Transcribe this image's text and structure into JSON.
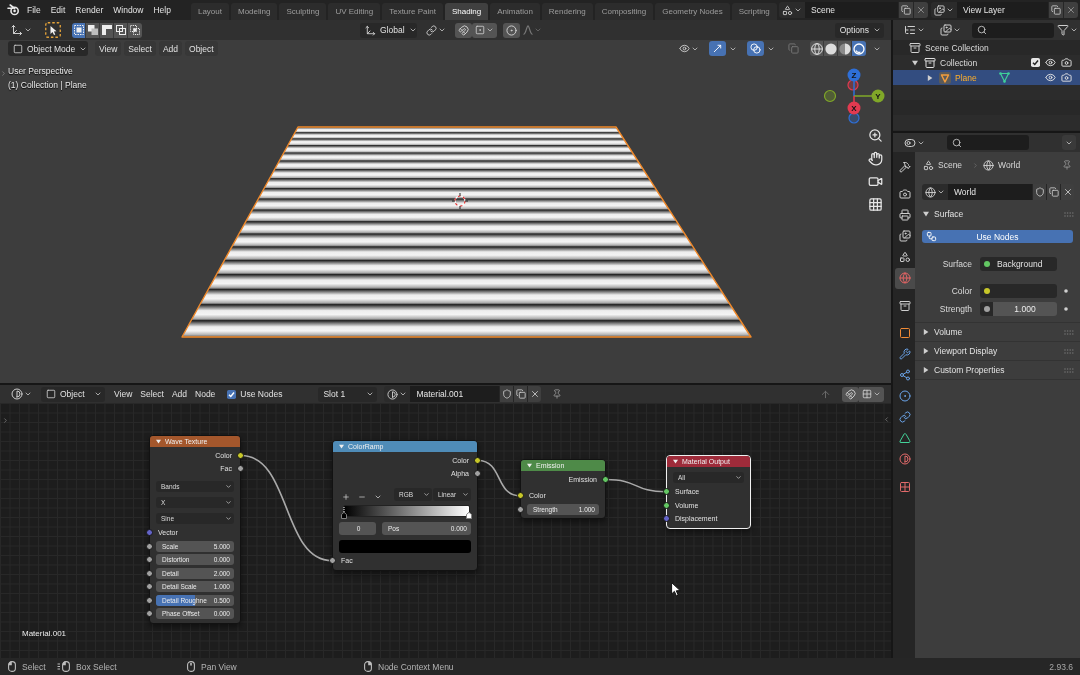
{
  "top_bar": {
    "menus": [
      "File",
      "Edit",
      "Render",
      "Window",
      "Help"
    ],
    "workspace_tabs": [
      {
        "label": "Layout",
        "selected": false
      },
      {
        "label": "Modeling",
        "selected": false
      },
      {
        "label": "Sculpting",
        "selected": false
      },
      {
        "label": "UV Editing",
        "selected": false
      },
      {
        "label": "Texture Paint",
        "selected": false
      },
      {
        "label": "Shading",
        "selected": true
      },
      {
        "label": "Animation",
        "selected": false
      },
      {
        "label": "Rendering",
        "selected": false
      },
      {
        "label": "Compositing",
        "selected": false
      },
      {
        "label": "Geometry Nodes",
        "selected": false
      },
      {
        "label": "Scripting",
        "selected": false
      }
    ],
    "scene": "Scene",
    "view_layer": "View Layer"
  },
  "viewport": {
    "tool_header": {
      "select_modes": [
        {
          "kind": "set",
          "selected": true
        },
        {
          "kind": "extend",
          "selected": false
        },
        {
          "kind": "subtract",
          "selected": false
        },
        {
          "kind": "difference",
          "selected": false
        },
        {
          "kind": "intersect",
          "selected": false
        }
      ],
      "orientation": "Global",
      "toggles": [
        {
          "kind": "snap",
          "on": false
        },
        {
          "kind": "proportional",
          "on": false
        }
      ],
      "options": "Options"
    },
    "header": {
      "mode": "Object Mode",
      "menus": [
        "View",
        "Select",
        "Add",
        "Object"
      ],
      "toggles": [
        {
          "kind": "gizmos",
          "on": true,
          "disabled": false
        },
        {
          "kind": "overlays",
          "on": true,
          "disabled": false
        },
        {
          "kind": "xray",
          "on": false,
          "disabled": true
        }
      ],
      "shading": [
        {
          "kind": "wireframe",
          "selected": false
        },
        {
          "kind": "solid",
          "selected": false
        },
        {
          "kind": "material",
          "selected": false
        },
        {
          "kind": "rendered",
          "selected": true
        }
      ]
    },
    "overlay_text": [
      "User Perspective",
      "(1) Collection | Plane"
    ],
    "gizmo": [
      {
        "label": "Z",
        "color": "#2e6fd8"
      },
      {
        "label": "Y",
        "color": "#80a828"
      },
      {
        "label": "X",
        "color": "#e23a50"
      }
    ]
  },
  "node_editor": {
    "header": {
      "object_type": "Object",
      "menus": [
        "View",
        "Select",
        "Add",
        "Node"
      ],
      "use_nodes": {
        "label": "Use Nodes",
        "checked": true
      },
      "slot": "Slot 1",
      "material": "Material.001",
      "toggles": [
        {
          "kind": "snap",
          "on": false
        }
      ]
    },
    "nodes": [
      {
        "title": "Wave Texture",
        "color": "#a4572c",
        "selected": false,
        "rows": [
          {
            "kind": "output",
            "label": "Color",
            "color": "#c7c729"
          },
          {
            "kind": "output",
            "label": "Fac",
            "color": "#a1a1a1"
          },
          {
            "kind": "dropdown",
            "value": "Bands"
          },
          {
            "kind": "dropdown",
            "value": "X"
          },
          {
            "kind": "dropdown",
            "value": "Sine"
          },
          {
            "kind": "input",
            "label": "Vector",
            "color": "#6363c7"
          },
          {
            "kind": "value",
            "label": "Scale",
            "value": "5.000",
            "color": "#a1a1a1"
          },
          {
            "kind": "value",
            "label": "Distortion",
            "value": "0.000",
            "color": "#a1a1a1"
          },
          {
            "kind": "value",
            "label": "Detail",
            "value": "2.000",
            "color": "#a1a1a1"
          },
          {
            "kind": "value",
            "label": "Detail Scale",
            "value": "1.000",
            "color": "#a1a1a1"
          },
          {
            "kind": "slider",
            "label": "Detail Roughne",
            "value": "0.500",
            "level": 0.5,
            "color": "#a1a1a1"
          },
          {
            "kind": "value",
            "label": "Phase Offset",
            "value": "0.000",
            "color": "#a1a1a1"
          }
        ]
      },
      {
        "title": "ColorRamp",
        "color": "#4f8cb8",
        "selected": false,
        "rows": [
          {
            "kind": "output",
            "label": "Color",
            "color": "#c7c729"
          },
          {
            "kind": "output",
            "label": "Alpha",
            "color": "#a1a1a1"
          },
          {
            "kind": "ramp_tools",
            "color_mode": "RGB",
            "interpolation": "Linear"
          },
          {
            "kind": "ramp",
            "stops": [
              {
                "color": "#000000",
                "selected": true
              },
              {
                "color": "#ffffff",
                "selected": false
              }
            ]
          },
          {
            "kind": "stop",
            "index": "0",
            "label": "Pos",
            "value": "0.000"
          },
          {
            "kind": "swatch",
            "color": "#000000"
          },
          {
            "kind": "input",
            "label": "Fac",
            "color": "#a1a1a1"
          }
        ]
      },
      {
        "title": "Emission",
        "color": "#4e8a48",
        "selected": false,
        "rows": [
          {
            "kind": "output",
            "label": "Emission",
            "color": "#63c763"
          },
          {
            "kind": "input",
            "label": "Color",
            "color": "#c7c729"
          },
          {
            "kind": "value",
            "label": "Strength",
            "value": "1.000",
            "color": "#a1a1a1"
          }
        ]
      },
      {
        "title": "Material Output",
        "color": "#9e2b3a",
        "selected": true,
        "rows": [
          {
            "kind": "dropdown",
            "value": "All"
          },
          {
            "kind": "input",
            "label": "Surface",
            "color": "#63c763"
          },
          {
            "kind": "input",
            "label": "Volume",
            "color": "#63c763"
          },
          {
            "kind": "input",
            "label": "Displacement",
            "color": "#6363c7"
          }
        ]
      }
    ],
    "material_label": "Material.001"
  },
  "outliner": {
    "items": [
      {
        "label": "Scene Collection",
        "kind": "scene_collection",
        "selected": false,
        "children": [
          {
            "label": "Collection",
            "kind": "collection",
            "expanded": true,
            "checked": true,
            "selected": false,
            "children": [
              {
                "label": "Plane",
                "kind": "object",
                "expanded": false,
                "selected": true
              }
            ]
          }
        ]
      }
    ]
  },
  "properties": {
    "tabs": [
      {
        "kind": "tool",
        "selected": false
      },
      {
        "kind": "render",
        "selected": false
      },
      {
        "kind": "output",
        "selected": false
      },
      {
        "kind": "view_layer",
        "selected": false
      },
      {
        "kind": "scene",
        "selected": false
      },
      {
        "kind": "world",
        "selected": true
      },
      {
        "kind": "collection",
        "selected": false
      },
      {
        "kind": "object",
        "selected": false
      },
      {
        "kind": "modifiers",
        "selected": false
      },
      {
        "kind": "particles",
        "selected": false
      },
      {
        "kind": "physics",
        "selected": false
      },
      {
        "kind": "constraints",
        "selected": false
      },
      {
        "kind": "data",
        "selected": false
      },
      {
        "kind": "material",
        "selected": false
      },
      {
        "kind": "texture",
        "selected": false
      }
    ],
    "breadcrumb": [
      "Scene",
      "World"
    ],
    "world": "World",
    "panels": [
      {
        "title": "Surface",
        "expanded": true,
        "button": "Use Nodes",
        "fields": [
          {
            "kind": "shader",
            "label": "Surface",
            "value": "Background",
            "color": "#63c763"
          },
          {
            "kind": "color",
            "label": "Color",
            "color": "#c7c729"
          },
          {
            "kind": "number",
            "label": "Strength",
            "value": "1.000",
            "color": "#a1a1a1"
          }
        ]
      },
      {
        "title": "Volume",
        "expanded": false
      },
      {
        "title": "Viewport Display",
        "expanded": false
      },
      {
        "title": "Custom Properties",
        "expanded": false
      }
    ]
  },
  "status_bar": {
    "hints": [
      {
        "kind": "left_click",
        "label": "Select"
      },
      {
        "kind": "left_drag",
        "label": "Box Select"
      },
      {
        "kind": "middle_click",
        "label": "Pan View"
      },
      {
        "kind": "right_click",
        "label": "Node Context Menu"
      }
    ],
    "version": "2.93.6"
  }
}
